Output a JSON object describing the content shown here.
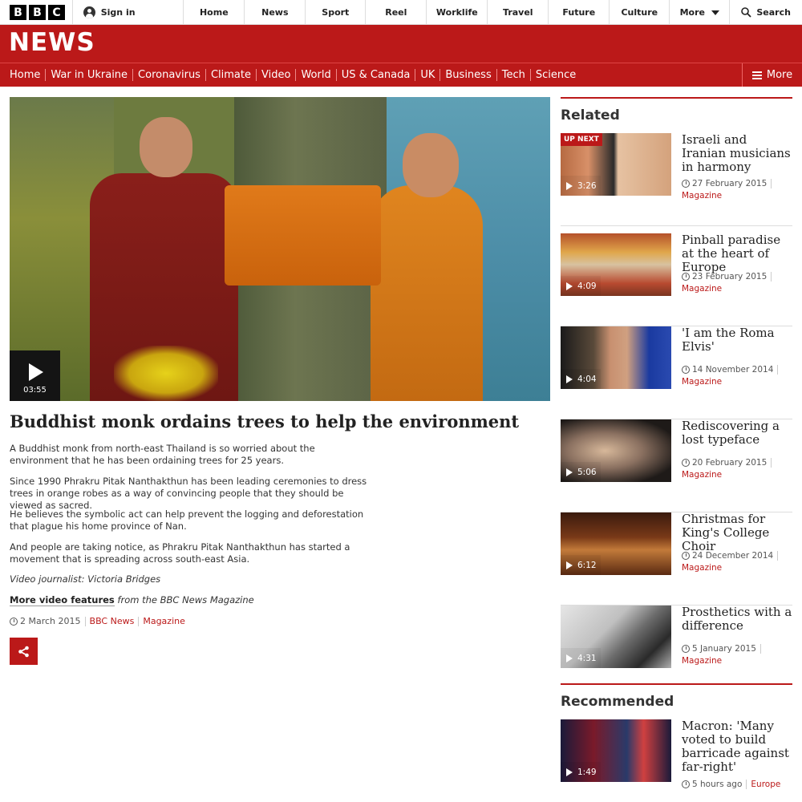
{
  "topbar": {
    "logo_letters": [
      "B",
      "B",
      "C"
    ],
    "sign_in": "Sign in",
    "nav": [
      {
        "label": "Home"
      },
      {
        "label": "News"
      },
      {
        "label": "Sport"
      },
      {
        "label": "Reel"
      },
      {
        "label": "Worklife"
      },
      {
        "label": "Travel"
      },
      {
        "label": "Future"
      },
      {
        "label": "Culture"
      },
      {
        "label": "More"
      }
    ],
    "search": "Search"
  },
  "masthead": {
    "title": "NEWS",
    "color": "#bb1919"
  },
  "section_nav": {
    "items": [
      "Home",
      "War in Ukraine",
      "Coronavirus",
      "Climate",
      "Video",
      "World",
      "US & Canada",
      "UK",
      "Business",
      "Tech",
      "Science"
    ],
    "more": "More"
  },
  "video": {
    "duration": "03:55"
  },
  "article": {
    "headline": "Buddhist monk ordains trees to help the environment",
    "paragraphs": [
      "A Buddhist monk from north-east Thailand is so worried about the environment that he has been ordaining trees for 25 years.",
      "Since 1990 Phrakru Pitak Nanthakthun has been leading ceremonies to dress trees in orange robes as a way of convincing people that they should be viewed as sacred.",
      "He believes the symbolic act can help prevent the logging and deforestation that plague his home province of Nan.",
      "And people are taking notice, as Phrakru Pitak Nanthakthun has started a movement that is spreading across south-east Asia."
    ],
    "journalist": "Video journalist: Victoria Bridges",
    "more_link": "More video features",
    "more_rest": " from the BBC News Magazine",
    "date": "2 March 2015",
    "source": "BBC News",
    "section": "Magazine"
  },
  "related": {
    "heading": "Related",
    "up_next": "UP NEXT",
    "items": [
      {
        "title": "Israeli and Iranian musicians in harmony",
        "date": "27 February 2015",
        "section": "Magazine",
        "duration": "3:26"
      },
      {
        "title": "Pinball paradise at the heart of Europe",
        "date": "23 February 2015",
        "section": "Magazine",
        "duration": "4:09"
      },
      {
        "title": "'I am the Roma Elvis'",
        "date": "14 November 2014",
        "section": "Magazine",
        "duration": "4:04"
      },
      {
        "title": "Rediscovering a lost typeface",
        "date": "20 February 2015",
        "section": "Magazine",
        "duration": "5:06"
      },
      {
        "title": "Christmas for King's College Choir",
        "date": "24 December 2014",
        "section": "Magazine",
        "duration": "6:12"
      },
      {
        "title": "Prosthetics with a difference",
        "date": "5 January 2015",
        "section": "Magazine",
        "duration": "4:31"
      }
    ]
  },
  "recommended": {
    "heading": "Recommended",
    "items": [
      {
        "title": "Macron: 'Many voted to build barricade against far-right'",
        "date": "5 hours ago",
        "section": "Europe",
        "duration": "1:49"
      }
    ]
  }
}
